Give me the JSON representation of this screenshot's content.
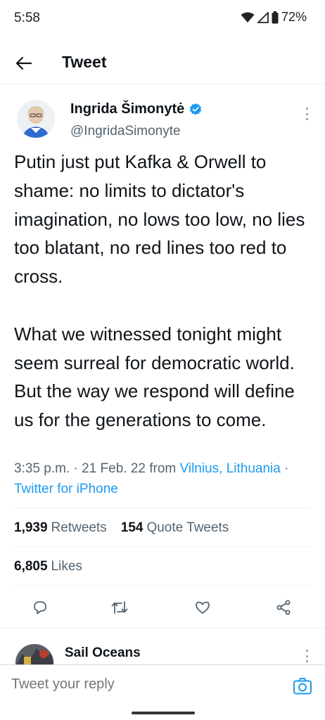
{
  "status_bar": {
    "time": "5:58",
    "battery": "72%",
    "icons": [
      "wifi-icon",
      "signal-icon",
      "battery-icon"
    ]
  },
  "header": {
    "title": "Tweet",
    "back_icon": "arrow-left-icon"
  },
  "tweet": {
    "author_name": "Ingrida Šimonytė",
    "author_handle": "@IngridaSimonyte",
    "verified": true,
    "paragraphs": [
      "Putin just put Kafka & Orwell to shame: no limits to dictator's imagination, no lows too low, no lies too blatant, no red lines too red to cross.",
      "What we witnessed tonight might seem surreal for democratic world. But the way we respond will define us for the generations to come."
    ],
    "time": "3:35 p.m.",
    "date": "21 Feb. 22",
    "from_label": "from",
    "location": "Vilnius, Lithuania",
    "separator": "·",
    "source": "Twitter for iPhone"
  },
  "stats": {
    "retweets_count": "1,939",
    "retweets_label": "Retweets",
    "quote_count": "154",
    "quote_label": "Quote Tweets",
    "likes_count": "6,805",
    "likes_label": "Likes"
  },
  "actions": [
    "reply-icon",
    "retweet-icon",
    "like-icon",
    "share-icon"
  ],
  "reply_preview": {
    "name": "Sail Oceans"
  },
  "composer": {
    "placeholder": "Tweet your reply",
    "camera_icon": "camera-icon"
  },
  "colors": {
    "accent": "#1d9bf0",
    "text": "#0f1419",
    "secondary": "#536471",
    "divider": "#eff3f4"
  }
}
